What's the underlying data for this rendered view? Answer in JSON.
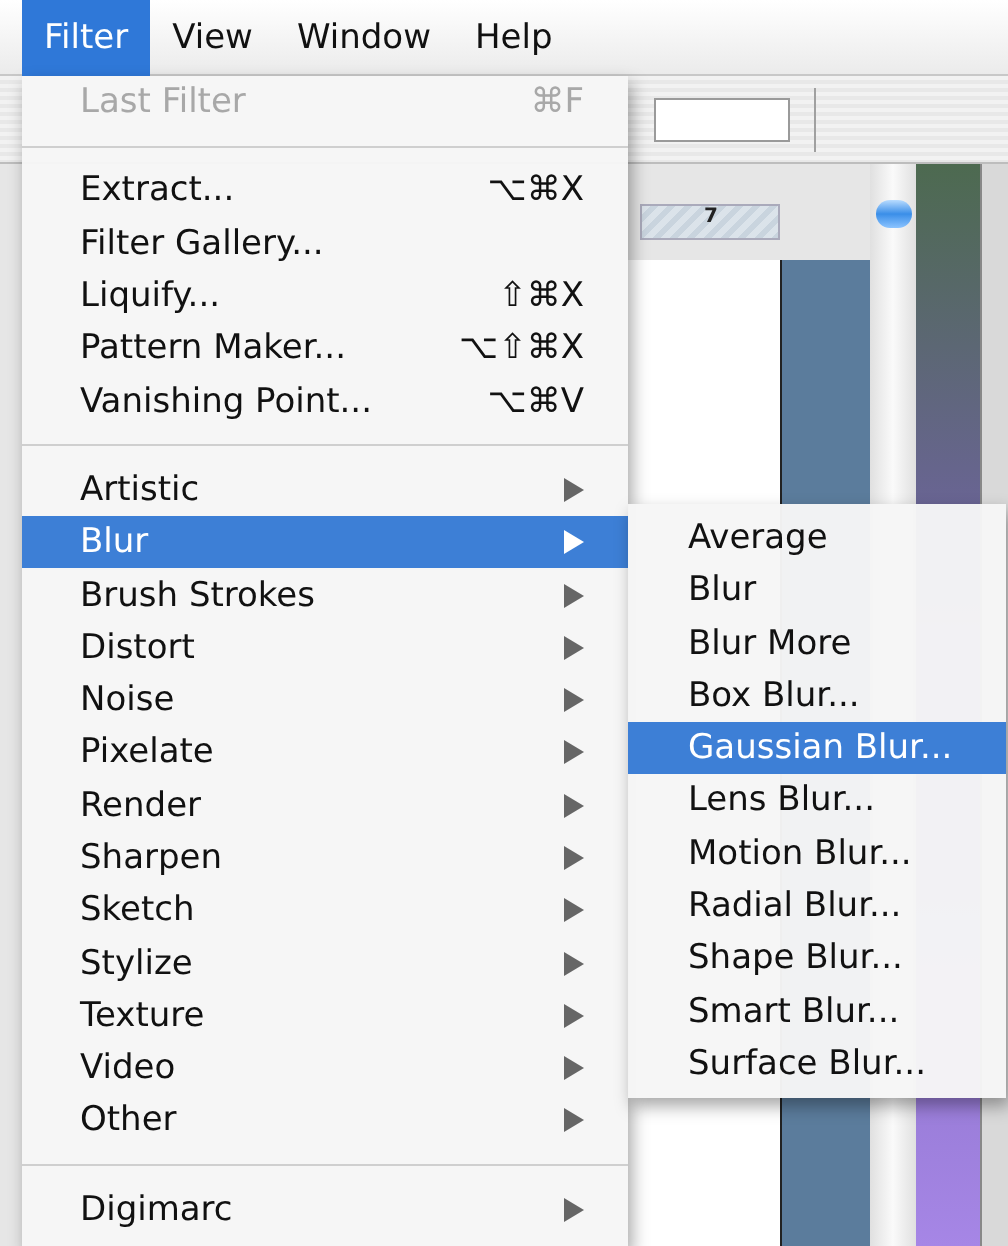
{
  "menubar": [
    {
      "label": "Filter",
      "selected": true
    },
    {
      "label": "View",
      "selected": false
    },
    {
      "label": "Window",
      "selected": false
    },
    {
      "label": "Help",
      "selected": false
    }
  ],
  "ruler_label": "7",
  "menu": {
    "items": [
      {
        "kind": "item",
        "label": "Last Filter",
        "shortcut": "⌘F",
        "disabled": true,
        "selected": false
      },
      {
        "kind": "separator"
      },
      {
        "kind": "item",
        "label": "Extract...",
        "shortcut": "⌥⌘X",
        "disabled": false,
        "selected": false
      },
      {
        "kind": "item",
        "label": "Filter Gallery...",
        "disabled": false,
        "selected": false
      },
      {
        "kind": "item",
        "label": "Liquify...",
        "shortcut": "⇧⌘X",
        "disabled": false,
        "selected": false
      },
      {
        "kind": "item",
        "label": "Pattern Maker...",
        "shortcut": "⌥⇧⌘X",
        "disabled": false,
        "selected": false
      },
      {
        "kind": "item",
        "label": "Vanishing Point...",
        "shortcut": "⌥⌘V",
        "disabled": false,
        "selected": false
      },
      {
        "kind": "separator"
      },
      {
        "kind": "submenu",
        "label": "Artistic",
        "disabled": false,
        "selected": false
      },
      {
        "kind": "submenu",
        "label": "Blur",
        "disabled": false,
        "selected": true
      },
      {
        "kind": "submenu",
        "label": "Brush Strokes",
        "disabled": false,
        "selected": false
      },
      {
        "kind": "submenu",
        "label": "Distort",
        "disabled": false,
        "selected": false
      },
      {
        "kind": "submenu",
        "label": "Noise",
        "disabled": false,
        "selected": false
      },
      {
        "kind": "submenu",
        "label": "Pixelate",
        "disabled": false,
        "selected": false
      },
      {
        "kind": "submenu",
        "label": "Render",
        "disabled": false,
        "selected": false
      },
      {
        "kind": "submenu",
        "label": "Sharpen",
        "disabled": false,
        "selected": false
      },
      {
        "kind": "submenu",
        "label": "Sketch",
        "disabled": false,
        "selected": false
      },
      {
        "kind": "submenu",
        "label": "Stylize",
        "disabled": false,
        "selected": false
      },
      {
        "kind": "submenu",
        "label": "Texture",
        "disabled": false,
        "selected": false
      },
      {
        "kind": "submenu",
        "label": "Video",
        "disabled": false,
        "selected": false
      },
      {
        "kind": "submenu",
        "label": "Other",
        "disabled": false,
        "selected": false
      },
      {
        "kind": "separator"
      },
      {
        "kind": "submenu",
        "label": "Digimarc",
        "disabled": false,
        "selected": false
      }
    ]
  },
  "submenu": {
    "items": [
      {
        "label": "Average",
        "selected": false
      },
      {
        "label": "Blur",
        "selected": false
      },
      {
        "label": "Blur More",
        "selected": false
      },
      {
        "label": "Box Blur...",
        "selected": false
      },
      {
        "label": "Gaussian Blur...",
        "selected": true
      },
      {
        "label": "Lens Blur...",
        "selected": false
      },
      {
        "label": "Motion Blur...",
        "selected": false
      },
      {
        "label": "Radial Blur...",
        "selected": false
      },
      {
        "label": "Shape Blur...",
        "selected": false
      },
      {
        "label": "Smart Blur...",
        "selected": false
      },
      {
        "label": "Surface Blur...",
        "selected": false
      }
    ]
  }
}
